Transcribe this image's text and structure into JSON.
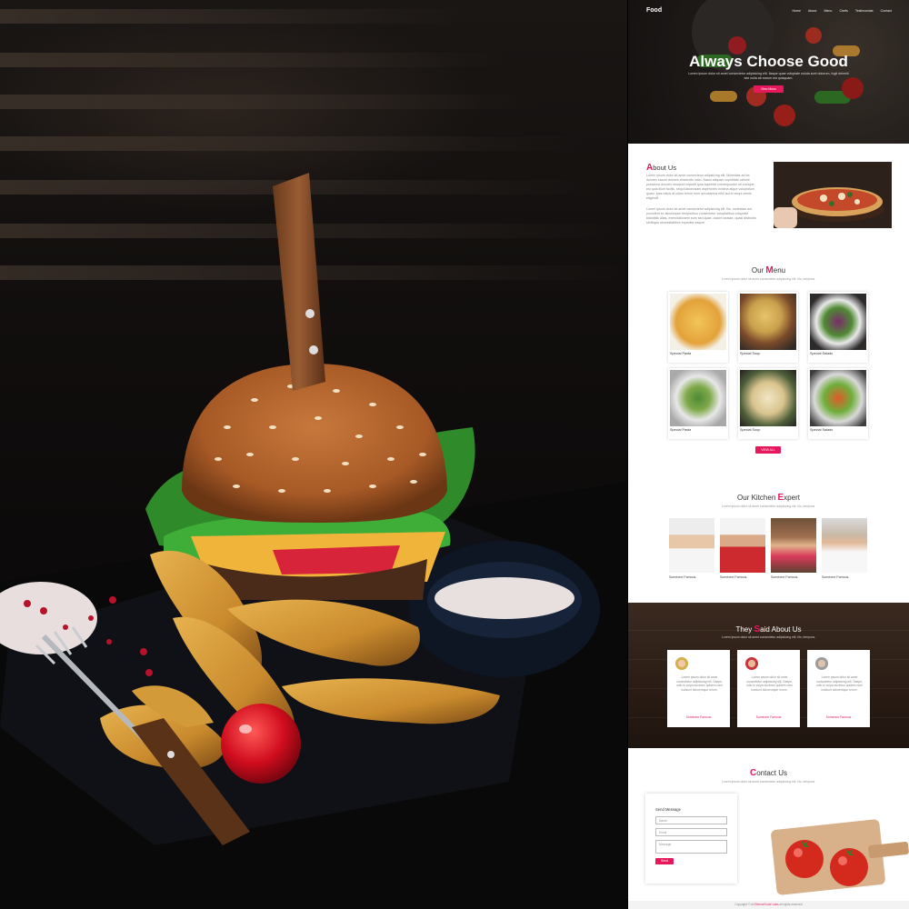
{
  "site": {
    "brand": "Food",
    "nav": [
      "Home",
      "About",
      "Menu",
      "Chefs",
      "Testimonials",
      "Contact"
    ],
    "hero": {
      "title": "Always Choose Good",
      "text": "Lorem ipsum dolor sit amet consectetur adipisicing elit. Itaque quae voluptate soluta sunt dolorum, fugit deleniti iste nulla ab earum est quisquam.",
      "button": "View Menu"
    },
    "about": {
      "title_first": "A",
      "title_rest": "bout Us",
      "p1": "Lorem ipsum dolor sit amet consectetur adipisicing elit. Molestias ad ea dolores earum dolores reiciendis iusto. Natus aliquam cupiditate ratione possimus dolores nesciunt impedit quia sapiente consequuntur sit cumque, est quia illum facilis, sequi laboriosam asperiores minima atque voluptatum quasi. Ipsa natus at ullam rerum eum accusamus nihil aut et sequi omnis eligendi!",
      "p2": "Lorem ipsum dolor sit amet consectetur adipisicing elit. Illo, molestias aut provident ex laboriosam temporibus consectetur voluptatibus voluptate blanditiis alias, exercitationem eum sed quae, dolore beatae, quasi distinctio similique necessitatibus expedita eaque!"
    },
    "menu": {
      "title_first": "Our ",
      "title_acc": "M",
      "title_rest": "enu",
      "subtitle": "Lorem ipsum dolor sit amet consectetur adipisicing elit. Illo, tempora.",
      "items": [
        {
          "label": "Special Pasta"
        },
        {
          "label": "Special Soup"
        },
        {
          "label": "Special Salads"
        },
        {
          "label": "Special Pasta"
        },
        {
          "label": "Special Soup"
        },
        {
          "label": "Special Salads"
        }
      ],
      "button": "VIEW ALL"
    },
    "chefs": {
      "title_first": "Our Kitchen ",
      "title_acc": "E",
      "title_rest": "xpert",
      "subtitle": "Lorem ipsum dolor sit amet consectetur adipisicing elit. Illo, tempora.",
      "names": [
        "Someone Famous",
        "Someone Famous",
        "Someone Famous",
        "Someone Famous"
      ]
    },
    "testimonials": {
      "title_first": "They ",
      "title_acc": "S",
      "title_rest": "aid About Us",
      "subtitle": "Lorem ipsum dolor sit amet consectetur adipisicing elit. Illo, tempora.",
      "cards": [
        {
          "text": "Lorem ipsum dolor sit amet consectetur adipisicing elit. Saepe, odio in culpa ducimus quidem nam incidunt doloremque rerum.",
          "name": "Someone Famous"
        },
        {
          "text": "Lorem ipsum dolor sit amet consectetur adipisicing elit. Saepe, odio in culpa ducimus quidem nam incidunt doloremque rerum.",
          "name": "Someone Famous"
        },
        {
          "text": "Lorem ipsum dolor sit amet consectetur adipisicing elit. Saepe, odio in culpa ducimus quidem nam incidunt doloremque rerum.",
          "name": "Someone Famous"
        }
      ]
    },
    "contact": {
      "title_acc": "C",
      "title_rest": "ontact Us",
      "subtitle": "Lorem ipsum dolor sit amet consectetur adipisicing elit. Illo, tempora.",
      "form_heading": "Send Message",
      "name_placeholder": "Name",
      "email_placeholder": "Email",
      "message_placeholder": "Message",
      "send_button": "Send"
    },
    "footer": {
      "prefix": "Copyright © All ",
      "link": "Eternal Kode Labs",
      "suffix": " all rights reserved"
    }
  },
  "colors": {
    "accent": "#e5185c"
  }
}
